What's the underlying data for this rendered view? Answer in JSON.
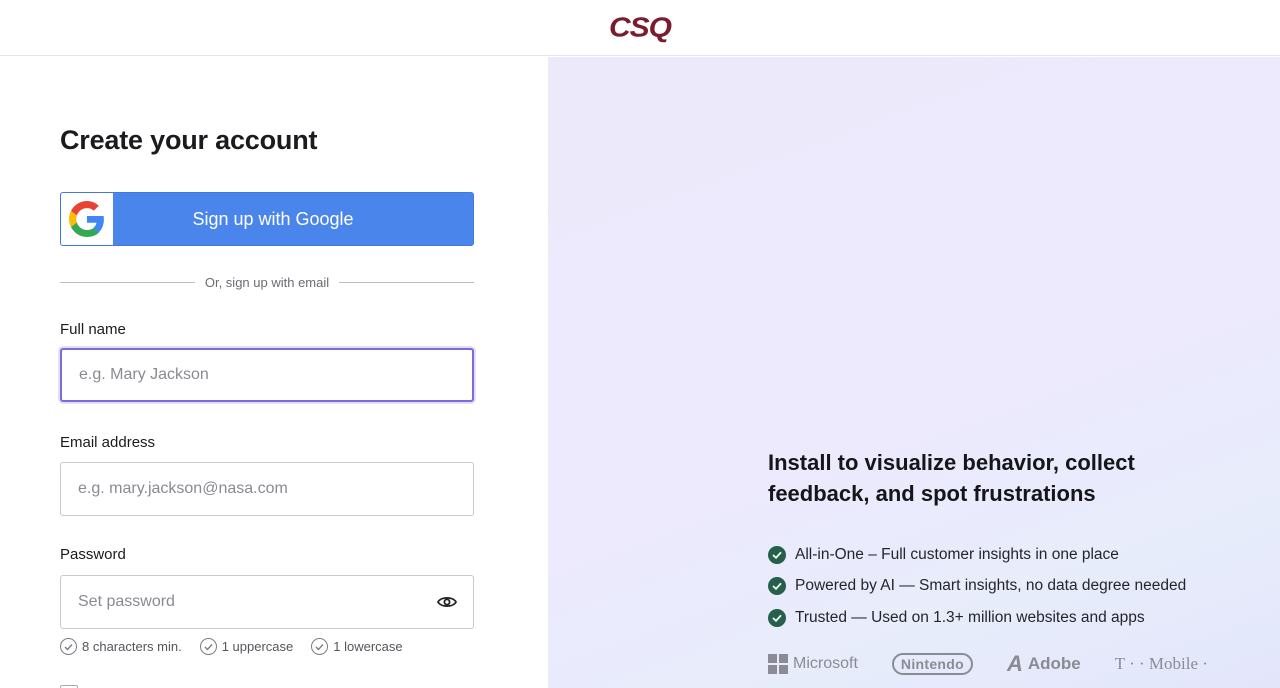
{
  "header": {
    "logo_text": "CSQ"
  },
  "form": {
    "title": "Create your account",
    "google_button_label": "Sign up with Google",
    "divider_text": "Or, sign up with email",
    "full_name": {
      "label": "Full name",
      "placeholder": "e.g. Mary Jackson",
      "value": ""
    },
    "email": {
      "label": "Email address",
      "placeholder": "e.g. mary.jackson@nasa.com",
      "value": ""
    },
    "password": {
      "label": "Password",
      "placeholder": "Set password",
      "value": ""
    },
    "password_rules": [
      "8 characters min.",
      "1 uppercase",
      "1 lowercase"
    ]
  },
  "promo": {
    "headline": "Install to visualize behavior, collect feedback, and spot frustrations",
    "features": [
      "All-in-One – Full customer insights in one place",
      "Powered by AI — Smart insights, no data degree needed",
      "Trusted — Used on 1.3+ million websites and apps"
    ],
    "brands": [
      "Microsoft",
      "Nintendo",
      "Adobe",
      "T · · Mobile ·"
    ]
  },
  "colors": {
    "brand": "#7a1b2e",
    "google_blue": "#4a85ec",
    "focus": "#7b6cd9",
    "check_green": "#24604a",
    "panel_bg": "#ece9fb"
  }
}
